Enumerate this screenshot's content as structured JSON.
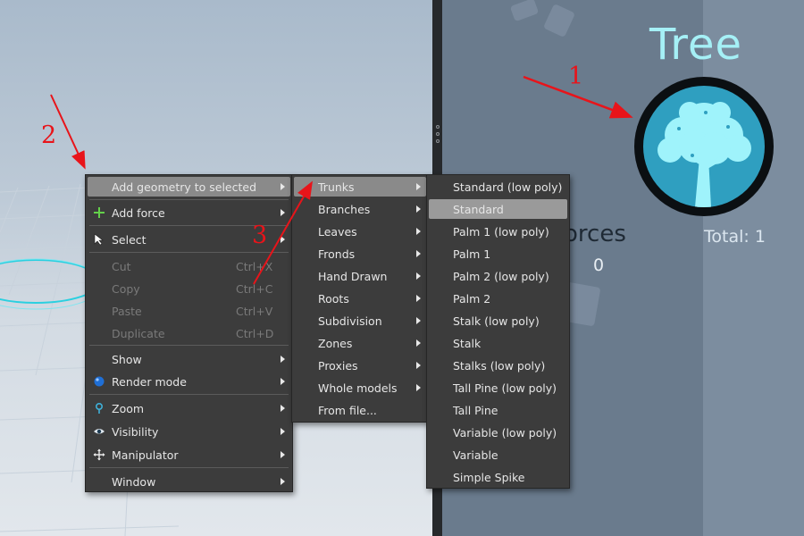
{
  "tree_panel": {
    "title": "Tree",
    "forces_label": "orces",
    "forces_value": "0",
    "total_label": "Total: 1",
    "badge_icon": "tree-icon",
    "badge_color": "#2f9fc0"
  },
  "context_menu": {
    "items": [
      {
        "label": "Add geometry to selected",
        "has_submenu": true,
        "highlighted": true
      },
      {
        "label": "Add force",
        "icon": "plus-icon",
        "has_submenu": true
      },
      {
        "label": "Select",
        "icon": "cursor-icon",
        "has_submenu": true
      },
      {
        "label": "Cut",
        "shortcut": "Ctrl+X",
        "disabled": true
      },
      {
        "label": "Copy",
        "shortcut": "Ctrl+C",
        "disabled": true
      },
      {
        "label": "Paste",
        "shortcut": "Ctrl+V",
        "disabled": true
      },
      {
        "label": "Duplicate",
        "shortcut": "Ctrl+D",
        "disabled": true
      },
      {
        "label": "Show",
        "has_submenu": true
      },
      {
        "label": "Render mode",
        "icon": "sphere-icon",
        "has_submenu": true
      },
      {
        "label": "Zoom",
        "icon": "magnifier-icon",
        "has_submenu": true
      },
      {
        "label": "Visibility",
        "icon": "eye-icon",
        "has_submenu": true
      },
      {
        "label": "Manipulator",
        "icon": "move-icon",
        "has_submenu": true
      },
      {
        "label": "Window",
        "has_submenu": true
      }
    ]
  },
  "geometry_submenu": {
    "items": [
      {
        "label": "Trunks",
        "highlighted": true
      },
      {
        "label": "Branches"
      },
      {
        "label": "Leaves"
      },
      {
        "label": "Fronds"
      },
      {
        "label": "Hand Drawn"
      },
      {
        "label": "Roots"
      },
      {
        "label": "Subdivision"
      },
      {
        "label": "Zones"
      },
      {
        "label": "Proxies"
      },
      {
        "label": "Whole models"
      },
      {
        "label": "From file..."
      }
    ]
  },
  "trunks_submenu": {
    "items": [
      {
        "label": "Standard (low poly)"
      },
      {
        "label": "Standard",
        "highlighted": true
      },
      {
        "label": "Palm 1 (low poly)"
      },
      {
        "label": "Palm 1"
      },
      {
        "label": "Palm 2 (low poly)"
      },
      {
        "label": "Palm 2"
      },
      {
        "label": "Stalk (low poly)"
      },
      {
        "label": "Stalk"
      },
      {
        "label": "Stalks (low poly)"
      },
      {
        "label": "Tall Pine (low poly)"
      },
      {
        "label": "Tall Pine"
      },
      {
        "label": "Variable (low poly)"
      },
      {
        "label": "Variable"
      },
      {
        "label": "Simple Spike"
      }
    ]
  },
  "annotations": {
    "one": "1",
    "two": "2",
    "three": "3",
    "color": "#e8141a"
  }
}
